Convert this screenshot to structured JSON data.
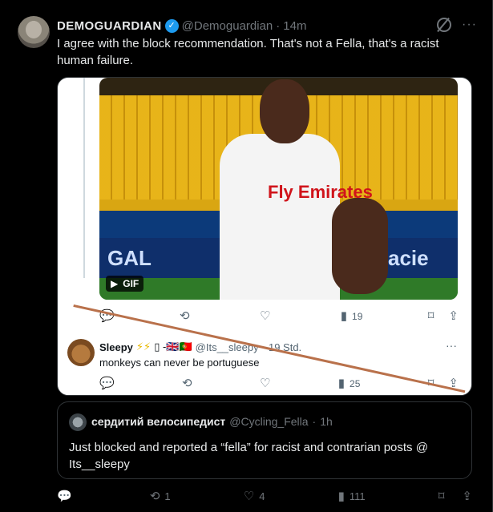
{
  "tweet": {
    "display_name": "DEMOGUARDIAN",
    "handle": "@Demoguardian",
    "separator": "·",
    "time": "14m",
    "text": "I agree with the block recommendation. That's not a Fella, that's a racist human failure.",
    "icons": {
      "verified": "verified-badge-icon",
      "grok": "grok-icon",
      "more": "more-icon"
    }
  },
  "embedded_card": {
    "media_badge": "GIF",
    "media_board_text": [
      "GAL",
      "acie"
    ],
    "media_shirt_text": "Fly Emirates",
    "top_actions": {
      "retweets": "",
      "likes": "",
      "views": "19"
    },
    "reply": {
      "display_name": "Sleepy",
      "emojis": "⚡⚡",
      "flags": "▯ -🇬🇧🇵🇹",
      "handle": "@Its__sleepy",
      "separator": "·",
      "time": "19 Std.",
      "text": "monkeys can never be portuguese",
      "actions": {
        "views": "25"
      }
    }
  },
  "quote": {
    "display_name": "сердитий велосипедист",
    "handle": "@Cycling_Fella",
    "separator": "·",
    "time": "1h",
    "text": "Just blocked and reported a “fella” for racist and contrarian posts @ Its__sleepy"
  },
  "actions": {
    "replies": "",
    "retweets": "1",
    "likes": "4",
    "views": "111"
  },
  "colors": {
    "background": "#000000",
    "accent": "#1d9bf0",
    "strike_line": "#b9714b"
  }
}
